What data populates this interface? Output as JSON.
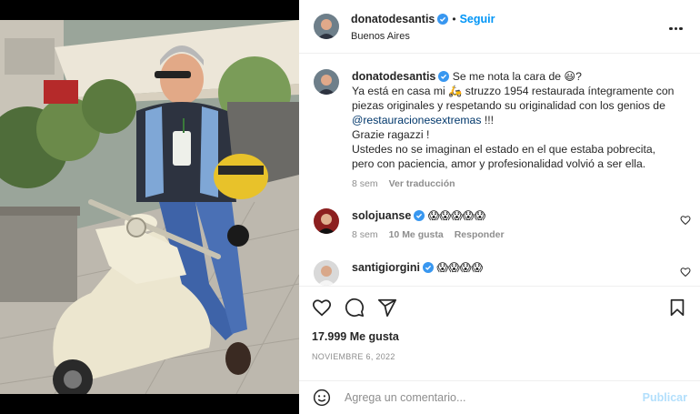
{
  "header": {
    "username": "donatodesantis",
    "follow_label": "Seguir",
    "location": "Buenos Aires",
    "separator": "•"
  },
  "caption": {
    "username": "donatodesantis",
    "line1_text": "Se me nota la cara de",
    "line1_emoji": "😃",
    "line1_end": "?",
    "line2_a": "Ya está en casa mi",
    "line2_emoji": "🛵",
    "line2_b": "struzzo 1954 restaurada íntegramente con",
    "line3": "piezas originales y respetando su originalidad con los genios de",
    "mention": "@restauracionesextremas",
    "mention_suffix": " !!!",
    "line5": "Grazie ragazzi !",
    "line6": "Ustedes no se imaginan el estado en el que estaba pobrecita,",
    "line7": "pero con paciencia, amor y profesionalidad volvió a ser ella.",
    "time": "8 sem",
    "translation_label": "Ver traducción"
  },
  "comments": [
    {
      "username": "solojuanse",
      "text": "😱😱😱😱😱",
      "time": "8 sem",
      "likes_label": "10 Me gusta",
      "reply_label": "Responder"
    },
    {
      "username": "santigiorgini",
      "text": "😱😱😱😱"
    }
  ],
  "post": {
    "likes": "17.999 Me gusta",
    "date": "Noviembre 6, 2022"
  },
  "add_comment": {
    "placeholder": "Agrega un comentario...",
    "publish_label": "Publicar"
  },
  "colors": {
    "accent": "#0095f6",
    "publish_disabled": "#b2dffc",
    "mention": "#00376b",
    "muted": "#8e8e8e",
    "verified": "#3897f0"
  },
  "icons": [
    "verified-badge-icon",
    "more-options-icon",
    "heart-icon",
    "comment-icon",
    "share-icon",
    "bookmark-icon",
    "emoji-icon"
  ]
}
